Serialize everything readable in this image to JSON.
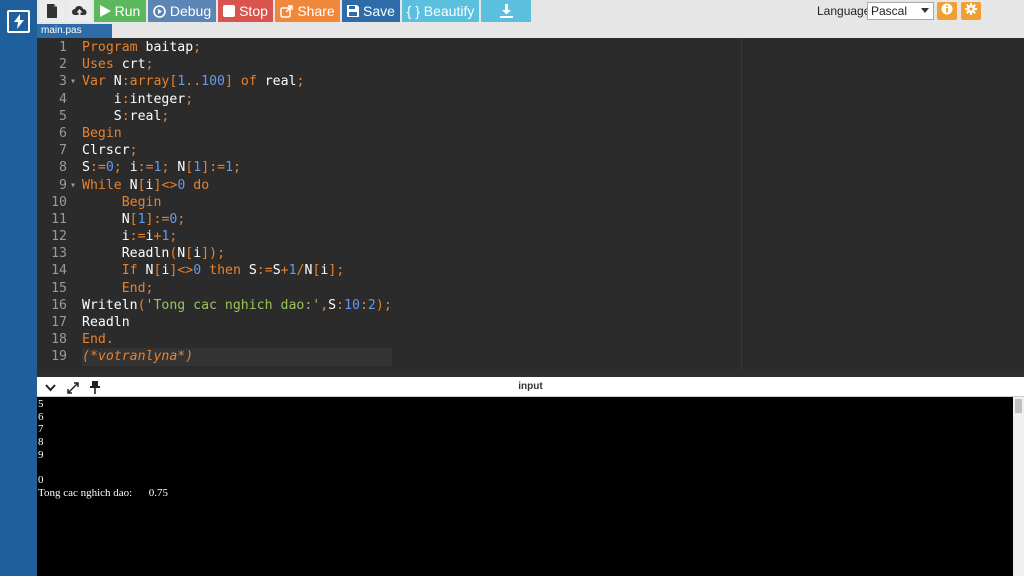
{
  "toolbar": {
    "run_label": "Run",
    "debug_label": "Debug",
    "stop_label": "Stop",
    "share_label": "Share",
    "save_label": "Save",
    "beautify_label": "{ } Beautify",
    "language_label": "Language",
    "language_value": "Pascal"
  },
  "editor": {
    "file_tab": "main.pas",
    "lines": [
      {
        "n": "1",
        "tokens": [
          [
            "kw",
            "Program"
          ],
          [
            "id",
            " baitap"
          ],
          [
            "op",
            ";"
          ]
        ]
      },
      {
        "n": "2",
        "tokens": [
          [
            "kw",
            "Uses"
          ],
          [
            "id",
            " crt"
          ],
          [
            "op",
            ";"
          ]
        ]
      },
      {
        "n": "3",
        "fold": "▾",
        "tokens": [
          [
            "kw",
            "Var"
          ],
          [
            "id",
            " N"
          ],
          [
            "op",
            ":"
          ],
          [
            "kw",
            "array"
          ],
          [
            "op",
            "["
          ],
          [
            "num",
            "1"
          ],
          [
            "op",
            ".."
          ],
          [
            "num",
            "100"
          ],
          [
            "op",
            "]"
          ],
          [
            "id",
            " "
          ],
          [
            "kw",
            "of"
          ],
          [
            "id",
            " real"
          ],
          [
            "op",
            ";"
          ]
        ]
      },
      {
        "n": "4",
        "tokens": [
          [
            "id",
            "    i"
          ],
          [
            "op",
            ":"
          ],
          [
            "id",
            "integer"
          ],
          [
            "op",
            ";"
          ]
        ]
      },
      {
        "n": "5",
        "tokens": [
          [
            "id",
            "    S"
          ],
          [
            "op",
            ":"
          ],
          [
            "id",
            "real"
          ],
          [
            "op",
            ";"
          ]
        ]
      },
      {
        "n": "6",
        "tokens": [
          [
            "kw",
            "Begin"
          ]
        ]
      },
      {
        "n": "7",
        "tokens": [
          [
            "id",
            "Clrscr"
          ],
          [
            "op",
            ";"
          ]
        ]
      },
      {
        "n": "8",
        "tokens": [
          [
            "id",
            "S"
          ],
          [
            "op",
            ":="
          ],
          [
            "num",
            "0"
          ],
          [
            "op",
            ";"
          ],
          [
            "id",
            " i"
          ],
          [
            "op",
            ":="
          ],
          [
            "num",
            "1"
          ],
          [
            "op",
            ";"
          ],
          [
            "id",
            " N"
          ],
          [
            "op",
            "["
          ],
          [
            "num",
            "1"
          ],
          [
            "op",
            "]"
          ],
          [
            "op",
            ":="
          ],
          [
            "num",
            "1"
          ],
          [
            "op",
            ";"
          ]
        ]
      },
      {
        "n": "9",
        "fold": "▾",
        "tokens": [
          [
            "kw",
            "While"
          ],
          [
            "id",
            " N"
          ],
          [
            "op",
            "["
          ],
          [
            "id",
            "i"
          ],
          [
            "op",
            "]"
          ],
          [
            "op",
            "<>"
          ],
          [
            "num",
            "0"
          ],
          [
            "id",
            " "
          ],
          [
            "kw",
            "do"
          ]
        ]
      },
      {
        "n": "10",
        "tokens": [
          [
            "id",
            "     "
          ],
          [
            "kw",
            "Begin"
          ]
        ]
      },
      {
        "n": "11",
        "tokens": [
          [
            "id",
            "     N"
          ],
          [
            "op",
            "["
          ],
          [
            "num",
            "1"
          ],
          [
            "op",
            "]"
          ],
          [
            "op",
            ":="
          ],
          [
            "num",
            "0"
          ],
          [
            "op",
            ";"
          ]
        ]
      },
      {
        "n": "12",
        "tokens": [
          [
            "id",
            "     i"
          ],
          [
            "op",
            ":="
          ],
          [
            "id",
            "i"
          ],
          [
            "op",
            "+"
          ],
          [
            "num",
            "1"
          ],
          [
            "op",
            ";"
          ]
        ]
      },
      {
        "n": "13",
        "tokens": [
          [
            "id",
            "     Readln"
          ],
          [
            "op",
            "("
          ],
          [
            "id",
            "N"
          ],
          [
            "op",
            "["
          ],
          [
            "id",
            "i"
          ],
          [
            "op",
            "]"
          ],
          [
            "op",
            ")"
          ],
          [
            "op",
            ";"
          ]
        ]
      },
      {
        "n": "14",
        "tokens": [
          [
            "id",
            "     "
          ],
          [
            "kw",
            "If"
          ],
          [
            "id",
            " N"
          ],
          [
            "op",
            "["
          ],
          [
            "id",
            "i"
          ],
          [
            "op",
            "]"
          ],
          [
            "op",
            "<>"
          ],
          [
            "num",
            "0"
          ],
          [
            "id",
            " "
          ],
          [
            "kw",
            "then"
          ],
          [
            "id",
            " S"
          ],
          [
            "op",
            ":="
          ],
          [
            "id",
            "S"
          ],
          [
            "op",
            "+"
          ],
          [
            "num",
            "1"
          ],
          [
            "op",
            "/"
          ],
          [
            "id",
            "N"
          ],
          [
            "op",
            "["
          ],
          [
            "id",
            "i"
          ],
          [
            "op",
            "]"
          ],
          [
            "op",
            ";"
          ]
        ]
      },
      {
        "n": "15",
        "tokens": [
          [
            "id",
            "     "
          ],
          [
            "kw",
            "End"
          ],
          [
            "op",
            ";"
          ]
        ]
      },
      {
        "n": "16",
        "tokens": [
          [
            "id",
            "Writeln"
          ],
          [
            "op",
            "("
          ],
          [
            "str",
            "'Tong cac nghich dao:'"
          ],
          [
            "op",
            ","
          ],
          [
            "id",
            "S"
          ],
          [
            "op",
            ":"
          ],
          [
            "num",
            "10"
          ],
          [
            "op",
            ":"
          ],
          [
            "num",
            "2"
          ],
          [
            "op",
            ")"
          ],
          [
            "op",
            ";"
          ]
        ]
      },
      {
        "n": "17",
        "tokens": [
          [
            "id",
            "Readln"
          ]
        ]
      },
      {
        "n": "18",
        "tokens": [
          [
            "kw",
            "End"
          ],
          [
            "op",
            "."
          ]
        ]
      },
      {
        "n": "19",
        "active": true,
        "tokens": [
          [
            "cm",
            "(*votranlyna*)"
          ]
        ]
      }
    ]
  },
  "io": {
    "title": "input",
    "output_lines": [
      "5",
      "6",
      "7",
      "8",
      "9",
      "",
      "0",
      "Tong cac nghich dao:      0.75"
    ]
  },
  "colors": {
    "sidebar": "#1f5f9c",
    "run": "#5cb85c",
    "debug": "#5a85b5",
    "stop": "#d9534f",
    "share": "#f0883c",
    "save": "#2d6ca8",
    "beautify": "#5bc0de",
    "editor_bg": "#2b2b2b",
    "terminal_bg": "#000000"
  },
  "icons": {
    "logo": "lightning-icon",
    "new_file": "file-icon",
    "upload": "cloud-upload-icon",
    "run": "play-icon",
    "debug": "debug-circle-icon",
    "stop": "stop-square-icon",
    "share": "share-icon",
    "save": "floppy-disk-icon",
    "download": "download-icon",
    "info": "info-icon",
    "settings": "gear-icon"
  }
}
